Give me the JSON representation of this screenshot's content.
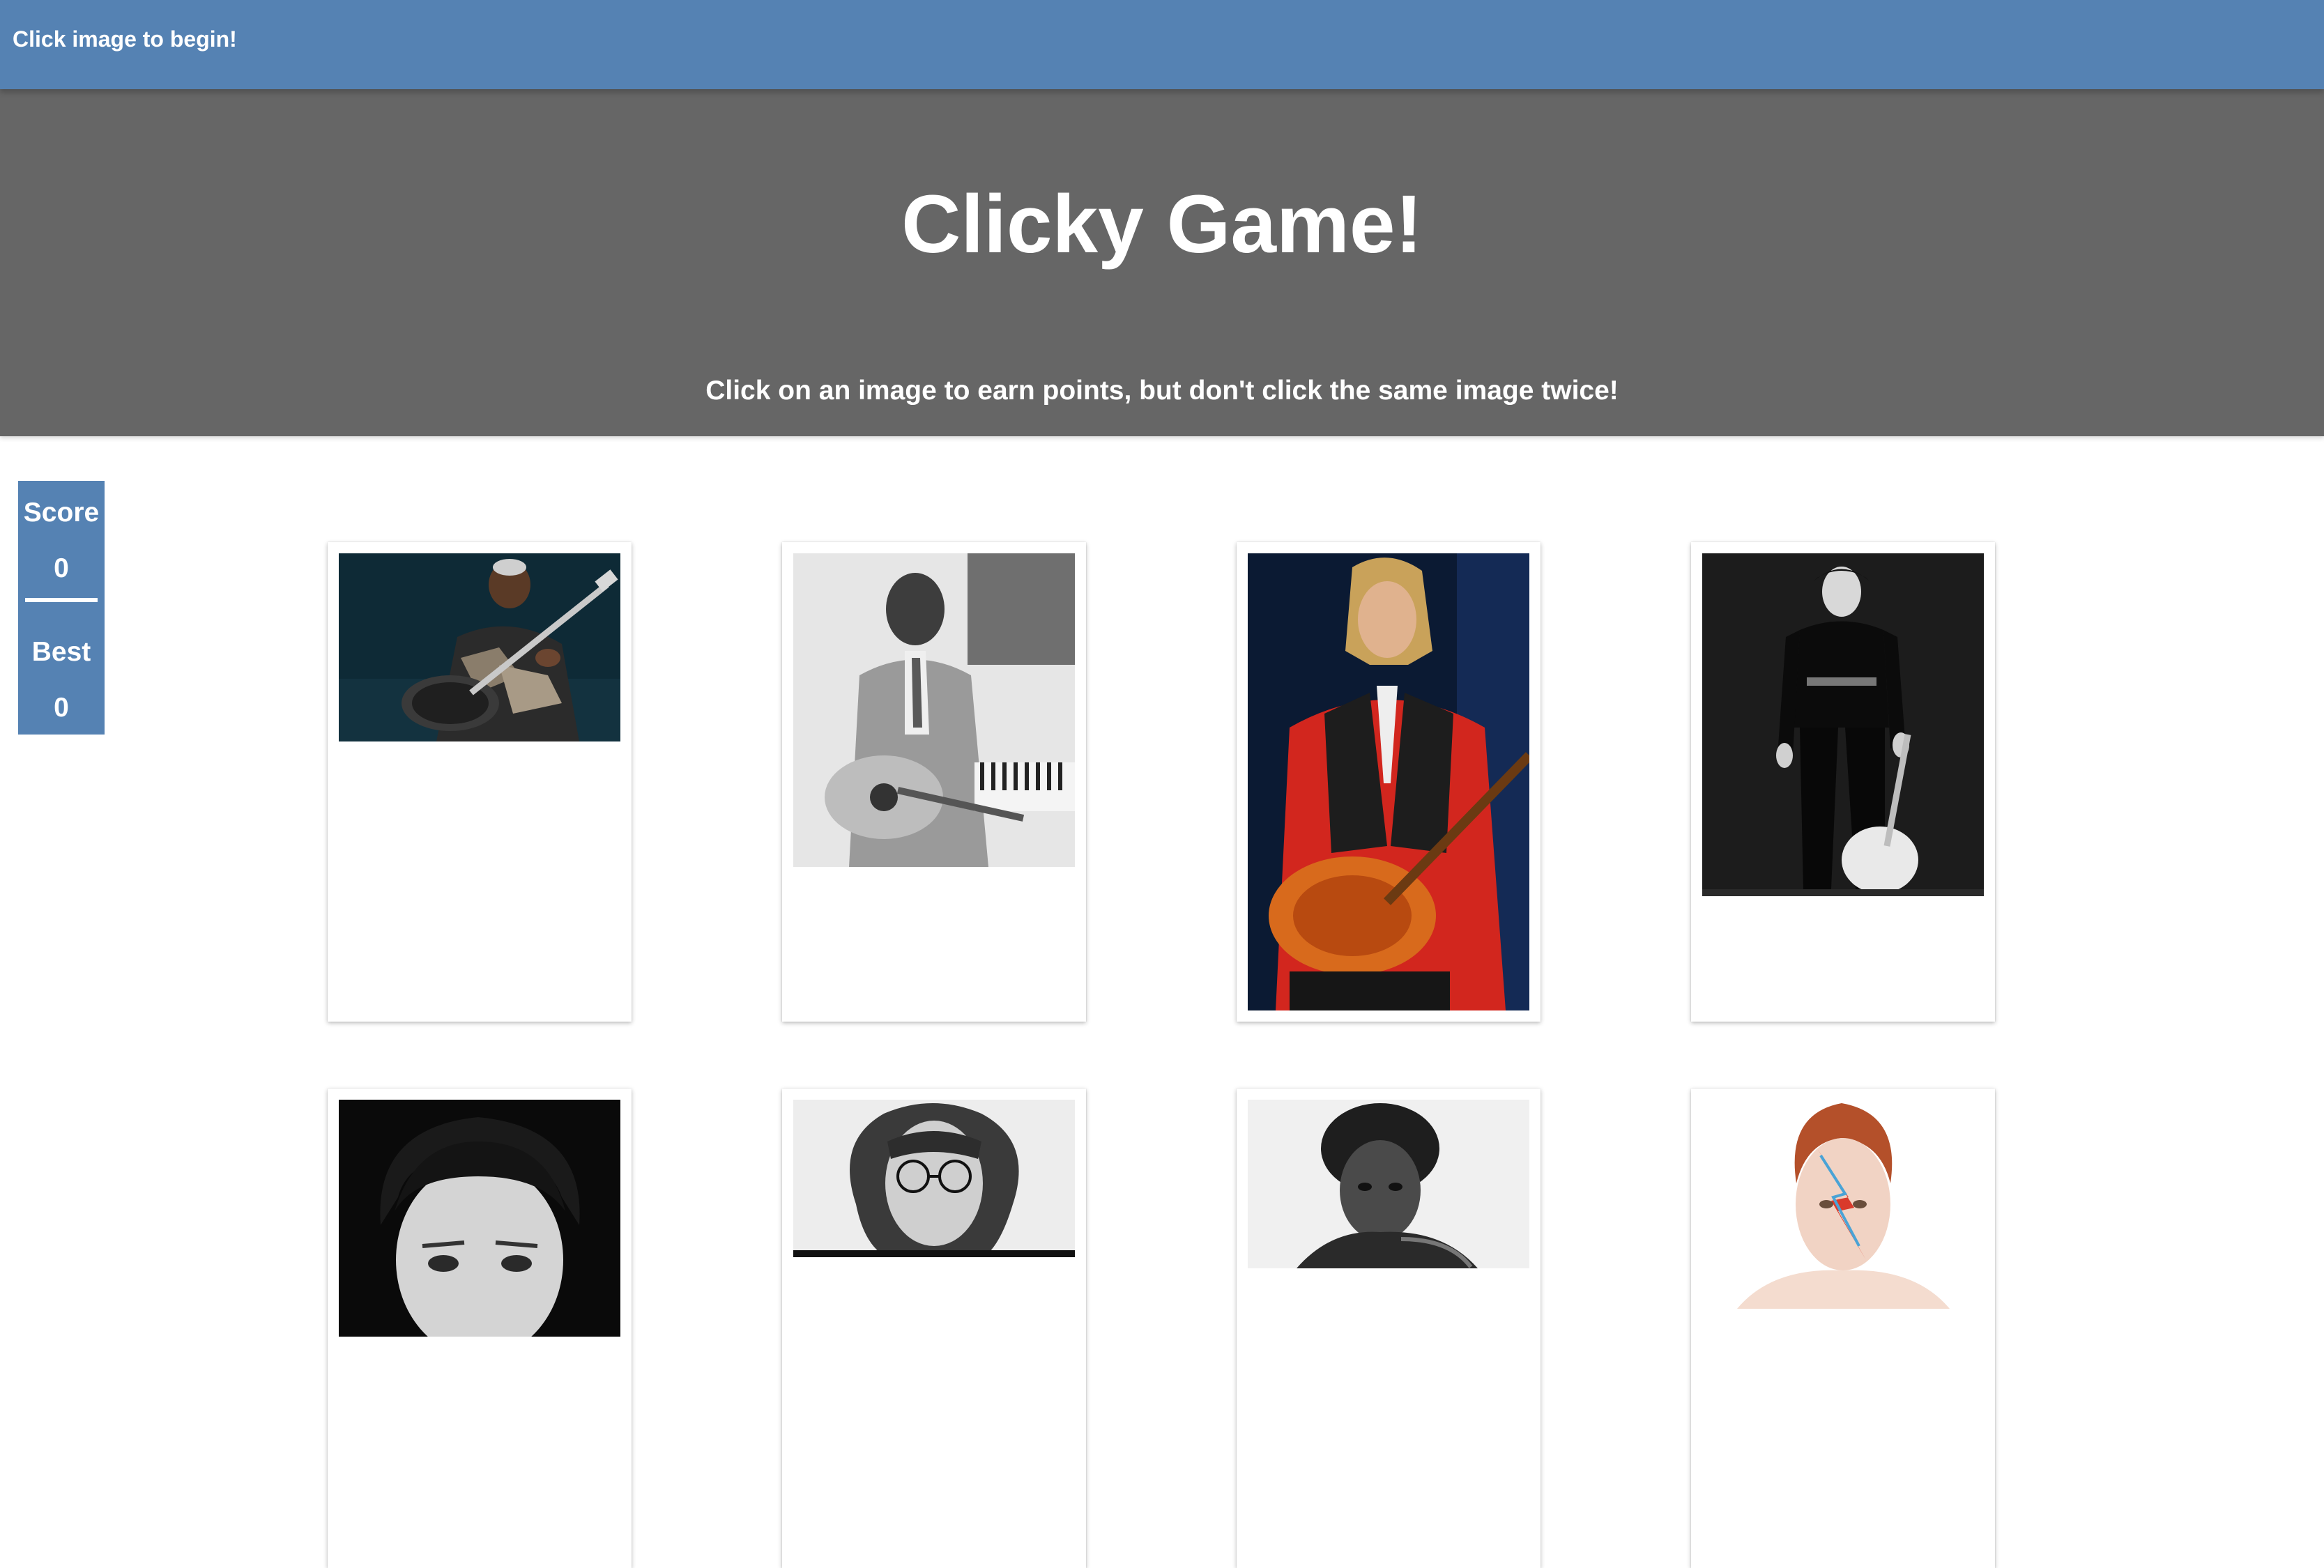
{
  "navbar": {
    "message": "Click image to begin!"
  },
  "header": {
    "title": "Clicky Game!",
    "subtitle": "Click on an image to earn points, but don't click the same image twice!"
  },
  "scoreboard": {
    "score_label": "Score",
    "score": "0",
    "best_label": "Best",
    "best": "0"
  },
  "cards": [
    {
      "subject": "guitarist-with-hollow-body-guitar"
    },
    {
      "subject": "vintage-blues-guitarist-photo"
    },
    {
      "subject": "rock-guitarist-red-shirt"
    },
    {
      "subject": "man-in-black-with-guitar"
    },
    {
      "subject": "black-and-white-portrait"
    },
    {
      "subject": "portrait-with-round-glasses"
    },
    {
      "subject": "portrait-with-curly-hair"
    },
    {
      "subject": "portrait-with-lightning-bolt-makeup"
    }
  ],
  "colors": {
    "navbar": "#5582b3",
    "header": "#666666",
    "scoreboard": "#5582b3",
    "text": "#ffffff"
  }
}
